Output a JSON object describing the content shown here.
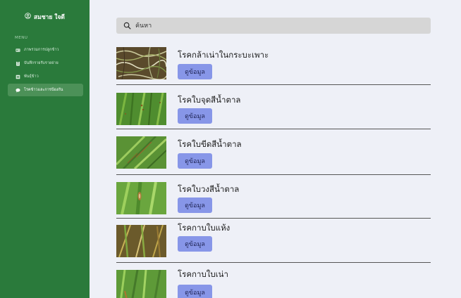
{
  "sidebar": {
    "user_name": "สมชาย ใจดี",
    "menu_label": "MENU",
    "items": [
      {
        "label": "ภาพรวมการปลูกข้าว",
        "icon": "id-card-icon",
        "active": false
      },
      {
        "label": "บันทึกรายรับรายจ่าย",
        "icon": "clipboard-icon",
        "active": false
      },
      {
        "label": "พันธุ์ข้าว",
        "icon": "list-icon",
        "active": false
      },
      {
        "label": "โรคข้าวและการป้องกัน",
        "icon": "chat-icon",
        "active": true
      }
    ]
  },
  "search": {
    "placeholder": "ค้นหา"
  },
  "diseases": [
    {
      "name": "โรคกล้าเน่าในกระบะเพาะ",
      "button": "ดูข้อมูล"
    },
    {
      "name": "โรคใบจุดสีน้ำตาล",
      "button": "ดูข้อมูล"
    },
    {
      "name": "โรคใบขีดสีน้ำตาล",
      "button": "ดูข้อมูล"
    },
    {
      "name": "โรคใบวงสีน้ำตาล",
      "button": "ดูข้อมูล"
    },
    {
      "name": "โรคกาบใบแห้ง",
      "button": "ดูข้อมูล"
    },
    {
      "name": "โรคกาบใบเน่า",
      "button": "ดูข้อมูล"
    }
  ],
  "colors": {
    "sidebar": "#2a7a3b",
    "active_item": "#4c9158",
    "button": "#8796e8",
    "background": "#eef0f7"
  }
}
